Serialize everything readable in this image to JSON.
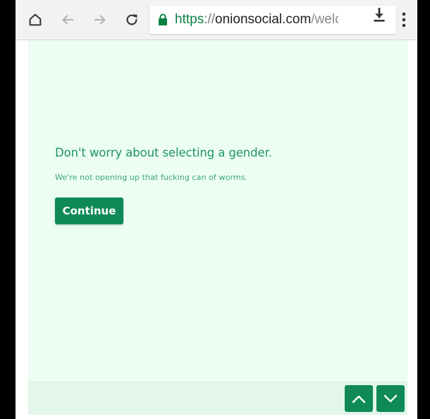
{
  "browser": {
    "url": {
      "scheme": "https",
      "separator": "://",
      "host": "onionsocial.com",
      "path": "/welc"
    }
  },
  "page": {
    "heading": "Don't worry about selecting a gender.",
    "subtext": "We're not opening up that fucking can of worms.",
    "continue_label": "Continue"
  },
  "colors": {
    "accent": "#0f8a57",
    "page_background": "#ecfdf2",
    "text_green": "#1f9463"
  },
  "icons": {
    "home": "home-icon",
    "back": "arrow-left-icon",
    "forward": "arrow-right-icon",
    "reload": "reload-icon",
    "lock": "lock-icon",
    "star": "star-icon",
    "download": "download-icon",
    "menu": "more-vertical-icon",
    "scroll_up": "chevron-up-icon",
    "scroll_down": "chevron-down-icon"
  }
}
